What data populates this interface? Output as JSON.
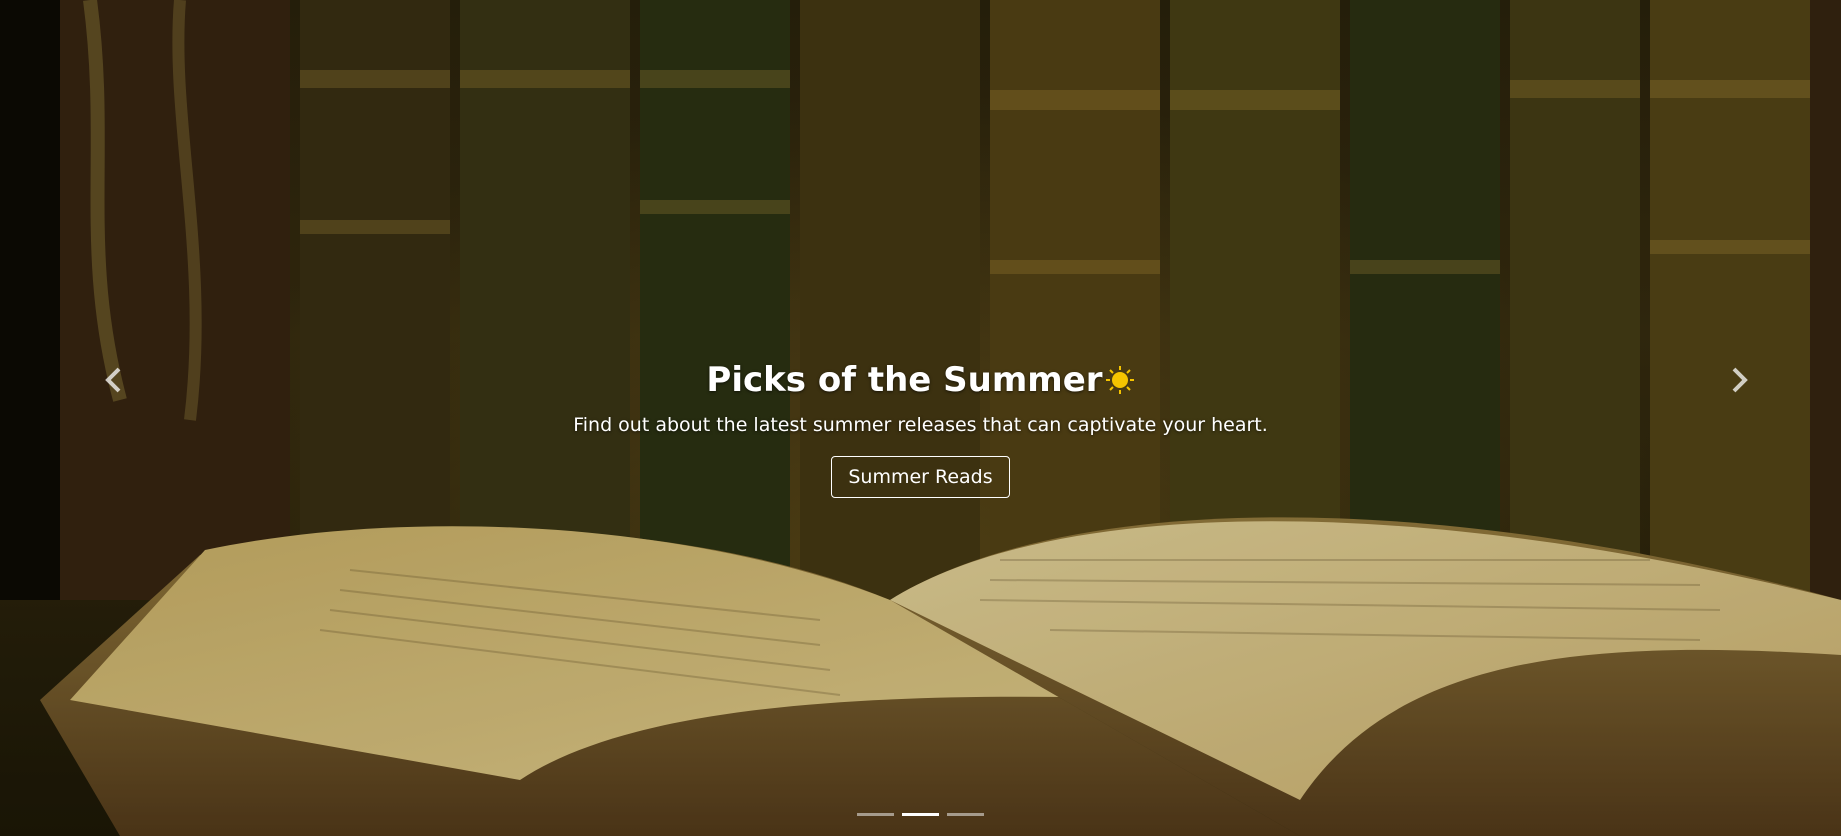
{
  "hero": {
    "title": "Picks of the Summer",
    "title_icon": "sun-icon",
    "subtitle": "Find out about the latest summer releases that can captivate your heart.",
    "cta_label": "Summer Reads"
  },
  "controls": {
    "prev_icon": "chevron-left-icon",
    "next_icon": "chevron-right-icon"
  },
  "carousel": {
    "slide_count": 3,
    "active_index": 1
  },
  "colors": {
    "sun": "#f5c400",
    "text": "#ffffff",
    "page_tint": "#e8c873"
  }
}
